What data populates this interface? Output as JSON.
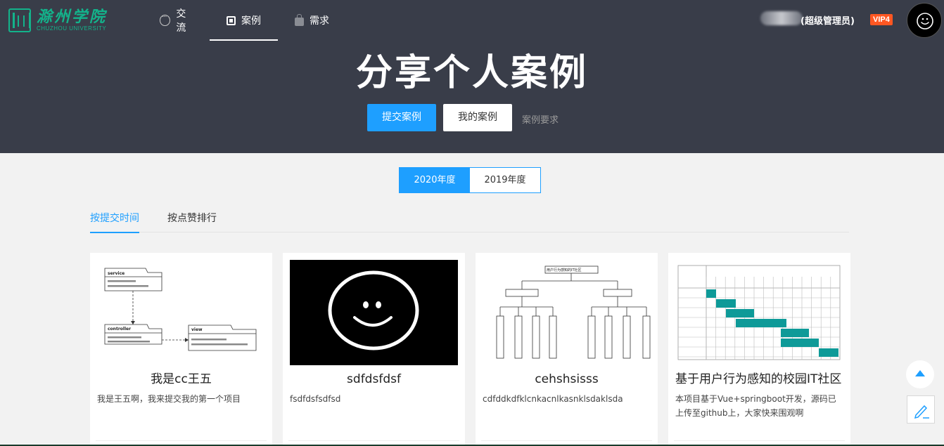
{
  "brand": {
    "name_cn": "滁州学院",
    "name_en": "CHUZHOU UNIVERSITY",
    "accent": "#13b38b"
  },
  "nav": {
    "items": [
      {
        "label": "交流",
        "icon": "chat-icon",
        "active": false
      },
      {
        "label": "案例",
        "icon": "chip-icon",
        "active": true
      },
      {
        "label": "需求",
        "icon": "bag-icon",
        "active": false
      }
    ]
  },
  "user": {
    "role": "(超级管理员)",
    "vip": "VIP4"
  },
  "hero": {
    "title": "分享个人案例",
    "submit_label": "提交案例",
    "mine_label": "我的案例",
    "requirements_link": "案例要求"
  },
  "years": [
    {
      "label": "2020年度",
      "active": true
    },
    {
      "label": "2019年度",
      "active": false
    }
  ],
  "sort_tabs": [
    {
      "label": "按提交时间",
      "active": true
    },
    {
      "label": "按点赞排行",
      "active": false
    }
  ],
  "cards": [
    {
      "title": "我是cc王五",
      "desc": "我是王五啊，我来提交我的第一个项目",
      "thumb": "package-diagram"
    },
    {
      "title": "sdfdsfdsf",
      "desc": "fsdfdsfsdfsd",
      "thumb": "smiley-image"
    },
    {
      "title": "cehshsisss",
      "desc": "cdfddkdfklcnkacnlkasnklsdaklsda",
      "thumb": "org-chart"
    },
    {
      "title": "基于用户行为感知的校园IT社区",
      "desc": "本项目基于Vue+springboot开发，源码已上传至github上，大家快来围观啊",
      "thumb": "gantt-chart"
    }
  ],
  "thumb_text": {
    "pkg_service": "service",
    "pkg_controller": "controller",
    "pkg_view": "view",
    "org_root": "用户行为感知的IT社区"
  },
  "colors": {
    "header_bg": "#393d49",
    "primary": "#1e9fff",
    "vip": "#ff5722",
    "page_bg": "#f2f2f2"
  }
}
